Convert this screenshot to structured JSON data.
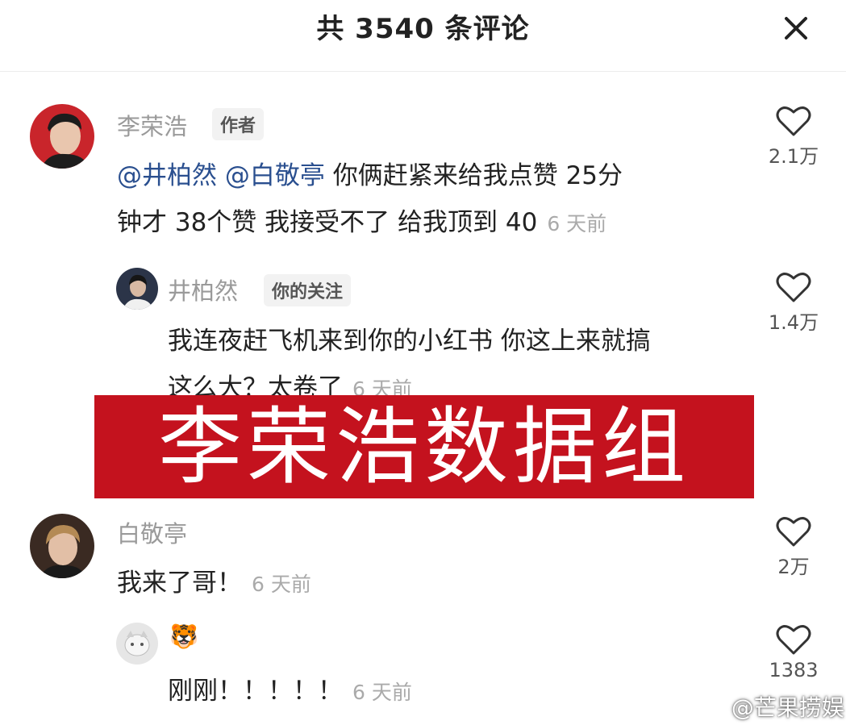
{
  "header": {
    "title": "共 3540 条评论"
  },
  "comments": [
    {
      "username": "李荣浩",
      "tag": "作者",
      "mention1": "@井柏然",
      "mention2": "@白敬亭",
      "line1_rest": "你俩赶紧来给我点赞  25分",
      "line2": "钟才 38个赞 我接受不了 给我顶到 40",
      "time": "6 天前",
      "likes": "2.1万"
    },
    {
      "username": "井柏然",
      "tag": "你的关注",
      "line1": "我连夜赶飞机来到你的小红书 你这上来就搞",
      "line2": "这么大？太卷了",
      "time": "6 天前",
      "likes": "1.4万"
    },
    {
      "username": "白敬亭",
      "line1": "我来了哥！",
      "time": "6 天前",
      "likes": "2万"
    },
    {
      "username": "🐯",
      "line1": "刚刚！！！！！",
      "time": "6 天前",
      "likes": "1383"
    }
  ],
  "banner": {
    "text": "李荣浩数据组"
  },
  "watermark": {
    "text": "@芒果捞娱"
  },
  "colors": {
    "banner": "#c4121e",
    "mention": "#2a4f8f",
    "username": "#9a9a9a"
  }
}
